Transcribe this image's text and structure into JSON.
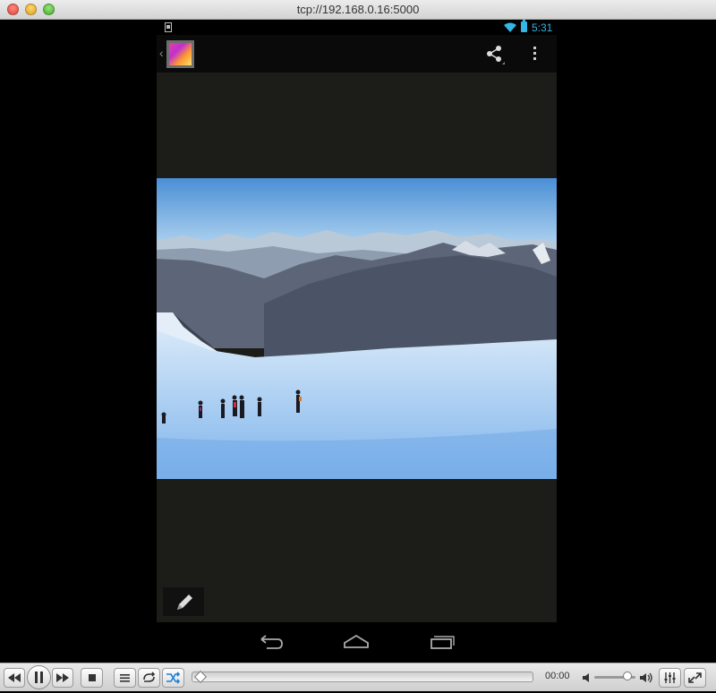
{
  "window": {
    "title": "tcp://192.168.0.16:5000"
  },
  "android": {
    "status_bar": {
      "time": "5:31"
    },
    "action_bar": {
      "icons": [
        "gallery-app-icon",
        "share-icon",
        "overflow-menu-icon"
      ]
    },
    "bottom_action": {
      "icon": "pencil-icon"
    },
    "nav_bar": {
      "icons": [
        "back-icon",
        "home-icon",
        "recents-icon"
      ]
    }
  },
  "player": {
    "elapsed": "00:00",
    "icons": [
      "rewind-icon",
      "pause-icon",
      "fast-forward-icon",
      "stop-icon",
      "playlist-icon",
      "loop-icon",
      "shuffle-icon",
      "volume-low-icon",
      "volume-high-icon",
      "equalizer-icon",
      "fullscreen-icon"
    ],
    "colors": {
      "accent": "#33b5e5"
    }
  }
}
